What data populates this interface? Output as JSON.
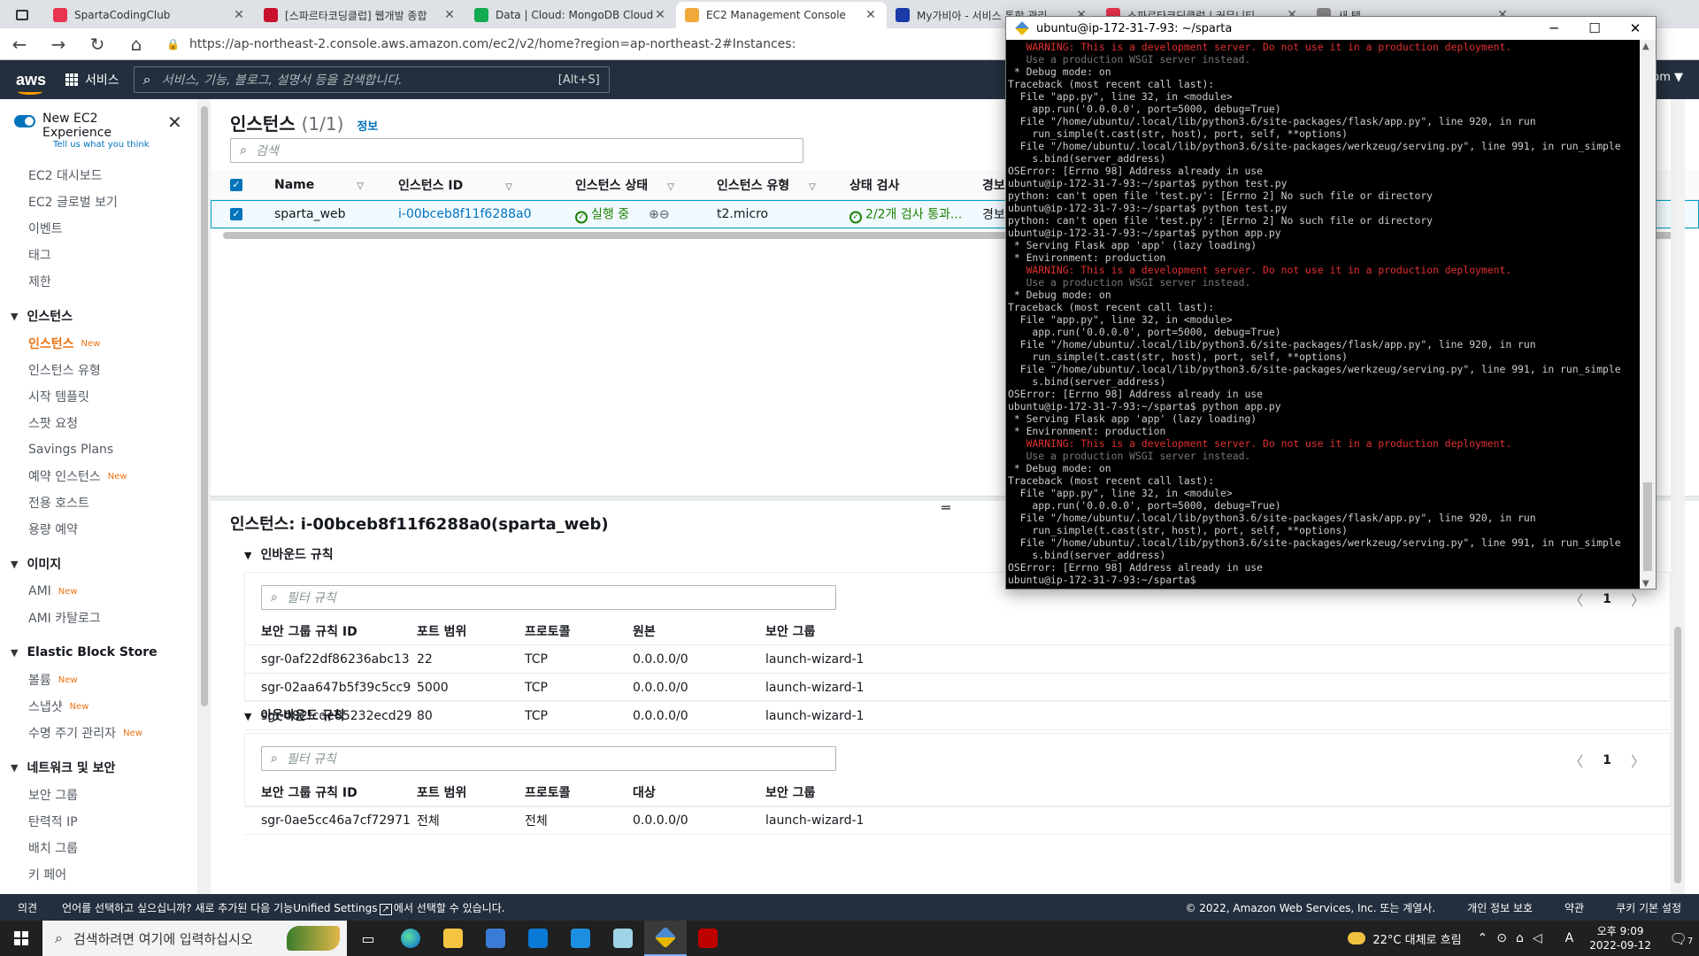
{
  "browser": {
    "tabs": [
      {
        "label": "SpartaCodingClub",
        "color": "#e8344e",
        "active": false
      },
      {
        "label": "[스파르타코딩클럽] 웹개발 종합",
        "color": "#c8102e",
        "active": false
      },
      {
        "label": "Data | Cloud: MongoDB Cloud",
        "color": "#13aa52",
        "active": false
      },
      {
        "label": "EC2 Management Console",
        "color": "#f2a93b",
        "active": true
      },
      {
        "label": "My가비아 - 서비스 통합 관리",
        "color": "#1a3aa8",
        "active": false
      },
      {
        "label": "스파르타코딩클럽 | 커뮤니티",
        "color": "#e8344e",
        "active": false
      },
      {
        "label": "새 탭",
        "color": "#888888",
        "active": false
      }
    ],
    "url": "https://ap-northeast-2.console.aws.amazon.com/ec2/v2/home?region=ap-northeast-2#Instances:"
  },
  "awsnav": {
    "logo": "aws",
    "services": "서비스",
    "search_placeholder": "서비스, 기능, 블로그, 설명서 등을 검색합니다.",
    "search_shortcut": "[Alt+S]",
    "account": "om ▼"
  },
  "sidebar": {
    "toggle_label": "New EC2 Experience",
    "toggle_sub": "Tell us what you think",
    "top_items": [
      {
        "label": "EC2 대시보드"
      },
      {
        "label": "EC2 글로벌 보기"
      },
      {
        "label": "이벤트"
      },
      {
        "label": "태그"
      },
      {
        "label": "제한"
      }
    ],
    "sections": [
      {
        "title": "인스턴스",
        "items": [
          {
            "label": "인스턴스",
            "badge": "New",
            "active": true
          },
          {
            "label": "인스턴스 유형",
            "badge": ""
          },
          {
            "label": "시작 템플릿",
            "badge": ""
          },
          {
            "label": "스팟 요청",
            "badge": ""
          },
          {
            "label": "Savings Plans",
            "badge": ""
          },
          {
            "label": "예약 인스턴스",
            "badge": "New"
          },
          {
            "label": "전용 호스트",
            "badge": ""
          },
          {
            "label": "용량 예약",
            "badge": ""
          }
        ]
      },
      {
        "title": "이미지",
        "items": [
          {
            "label": "AMI",
            "badge": "New"
          },
          {
            "label": "AMI 카탈로그",
            "badge": ""
          }
        ]
      },
      {
        "title": "Elastic Block Store",
        "items": [
          {
            "label": "볼륨",
            "badge": "New"
          },
          {
            "label": "스냅샷",
            "badge": "New"
          },
          {
            "label": "수명 주기 관리자",
            "badge": "New"
          }
        ]
      },
      {
        "title": "네트워크 및 보안",
        "items": [
          {
            "label": "보안 그룹",
            "badge": ""
          },
          {
            "label": "탄력적 IP",
            "badge": ""
          },
          {
            "label": "배치 그룹",
            "badge": ""
          },
          {
            "label": "키 페어",
            "badge": ""
          }
        ]
      }
    ]
  },
  "instances": {
    "title": "인스턴스",
    "count": "(1/1)",
    "info": "정보",
    "search_placeholder": "검색",
    "columns": [
      "Name",
      "인스턴스 ID",
      "인스턴스 상태",
      "인스턴스 유형",
      "상태 검사",
      "경보"
    ],
    "row": {
      "name": "sparta_web",
      "id": "i-00bceb8f11f6288a0",
      "state": "실행 중",
      "type": "t2.micro",
      "check": "2/2개 검사 통과...",
      "alarm": "경보"
    }
  },
  "detail": {
    "title": "인스턴스: i-00bceb8f11f6288a0(sparta_web)",
    "inbound": {
      "title": "인바운드 규칙",
      "filter_placeholder": "필터 규칙",
      "page": "1",
      "columns": [
        "보안 그룹 규칙 ID",
        "포트 범위",
        "프로토콜",
        "원본",
        "보안 그룹"
      ],
      "rows": [
        [
          "sgr-0af22df86236abc13",
          "22",
          "TCP",
          "0.0.0.0/0",
          "launch-wizard-1"
        ],
        [
          "sgr-02aa647b5f39c5cc9",
          "5000",
          "TCP",
          "0.0.0.0/0",
          "launch-wizard-1"
        ],
        [
          "sgr-082fcde85232ecd29",
          "80",
          "TCP",
          "0.0.0.0/0",
          "launch-wizard-1"
        ]
      ]
    },
    "outbound": {
      "title": "아웃바운드 규칙",
      "filter_placeholder": "필터 규칙",
      "page": "1",
      "columns": [
        "보안 그룹 규칙 ID",
        "포트 범위",
        "프로토콜",
        "대상",
        "보안 그룹"
      ],
      "rows": [
        [
          "sgr-0ae5cc46a7cf72971",
          "전체",
          "전체",
          "0.0.0.0/0",
          "launch-wizard-1"
        ]
      ]
    }
  },
  "terminal": {
    "title": "ubuntu@ip-172-31-7-93: ~/sparta",
    "lines": [
      {
        "t": "   WARNING: This is a development server. Do not use it in a production deployment.",
        "c": "red"
      },
      {
        "t": "   Use a production WSGI server instead.",
        "c": "dim"
      },
      {
        "t": " * Debug mode: on",
        "c": ""
      },
      {
        "t": "Traceback (most recent call last):",
        "c": ""
      },
      {
        "t": "  File \"app.py\", line 32, in <module>",
        "c": ""
      },
      {
        "t": "    app.run('0.0.0.0', port=5000, debug=True)",
        "c": ""
      },
      {
        "t": "  File \"/home/ubuntu/.local/lib/python3.6/site-packages/flask/app.py\", line 920, in run",
        "c": ""
      },
      {
        "t": "    run_simple(t.cast(str, host), port, self, **options)",
        "c": ""
      },
      {
        "t": "  File \"/home/ubuntu/.local/lib/python3.6/site-packages/werkzeug/serving.py\", line 991, in run_simple",
        "c": ""
      },
      {
        "t": "    s.bind(server_address)",
        "c": ""
      },
      {
        "t": "OSError: [Errno 98] Address already in use",
        "c": ""
      },
      {
        "t": "ubuntu@ip-172-31-7-93:~/sparta$ python test.py",
        "c": ""
      },
      {
        "t": "python: can't open file 'test.py': [Errno 2] No such file or directory",
        "c": ""
      },
      {
        "t": "ubuntu@ip-172-31-7-93:~/sparta$ python test.py",
        "c": ""
      },
      {
        "t": "python: can't open file 'test.py': [Errno 2] No such file or directory",
        "c": ""
      },
      {
        "t": "ubuntu@ip-172-31-7-93:~/sparta$ python app.py",
        "c": ""
      },
      {
        "t": " * Serving Flask app 'app' (lazy loading)",
        "c": ""
      },
      {
        "t": " * Environment: production",
        "c": ""
      },
      {
        "t": "   WARNING: This is a development server. Do not use it in a production deployment.",
        "c": "red"
      },
      {
        "t": "   Use a production WSGI server instead.",
        "c": "dim"
      },
      {
        "t": " * Debug mode: on",
        "c": ""
      },
      {
        "t": "Traceback (most recent call last):",
        "c": ""
      },
      {
        "t": "  File \"app.py\", line 32, in <module>",
        "c": ""
      },
      {
        "t": "    app.run('0.0.0.0', port=5000, debug=True)",
        "c": ""
      },
      {
        "t": "  File \"/home/ubuntu/.local/lib/python3.6/site-packages/flask/app.py\", line 920, in run",
        "c": ""
      },
      {
        "t": "    run_simple(t.cast(str, host), port, self, **options)",
        "c": ""
      },
      {
        "t": "  File \"/home/ubuntu/.local/lib/python3.6/site-packages/werkzeug/serving.py\", line 991, in run_simple",
        "c": ""
      },
      {
        "t": "    s.bind(server_address)",
        "c": ""
      },
      {
        "t": "OSError: [Errno 98] Address already in use",
        "c": ""
      },
      {
        "t": "ubuntu@ip-172-31-7-93:~/sparta$ python app.py",
        "c": ""
      },
      {
        "t": " * Serving Flask app 'app' (lazy loading)",
        "c": ""
      },
      {
        "t": " * Environment: production",
        "c": ""
      },
      {
        "t": "   WARNING: This is a development server. Do not use it in a production deployment.",
        "c": "red"
      },
      {
        "t": "   Use a production WSGI server instead.",
        "c": "dim"
      },
      {
        "t": " * Debug mode: on",
        "c": ""
      },
      {
        "t": "Traceback (most recent call last):",
        "c": ""
      },
      {
        "t": "  File \"app.py\", line 32, in <module>",
        "c": ""
      },
      {
        "t": "    app.run('0.0.0.0', port=5000, debug=True)",
        "c": ""
      },
      {
        "t": "  File \"/home/ubuntu/.local/lib/python3.6/site-packages/flask/app.py\", line 920, in run",
        "c": ""
      },
      {
        "t": "    run_simple(t.cast(str, host), port, self, **options)",
        "c": ""
      },
      {
        "t": "  File \"/home/ubuntu/.local/lib/python3.6/site-packages/werkzeug/serving.py\", line 991, in run_simple",
        "c": ""
      },
      {
        "t": "    s.bind(server_address)",
        "c": ""
      },
      {
        "t": "OSError: [Errno 98] Address already in use",
        "c": ""
      },
      {
        "t": "ubuntu@ip-172-31-7-93:~/sparta$",
        "c": ""
      }
    ]
  },
  "footer": {
    "feedback": "의견",
    "lang_text": "언어를 선택하고 싶으십니까? 새로 추가된 다음 기능Unified Settings",
    "lang_suffix": "에서 선택할 수 있습니다.",
    "copyright": "© 2022, Amazon Web Services, Inc. 또는 계열사.",
    "privacy": "개인 정보 보호",
    "terms": "약관",
    "cookies": "쿠키 기본 설정"
  },
  "taskbar": {
    "search_placeholder": "검색하려면 여기에 입력하십시오",
    "weather": "22°C 대체로 흐림",
    "time": "오후 9:09",
    "date": "2022-09-12",
    "ime": "A",
    "notifications": "7"
  }
}
